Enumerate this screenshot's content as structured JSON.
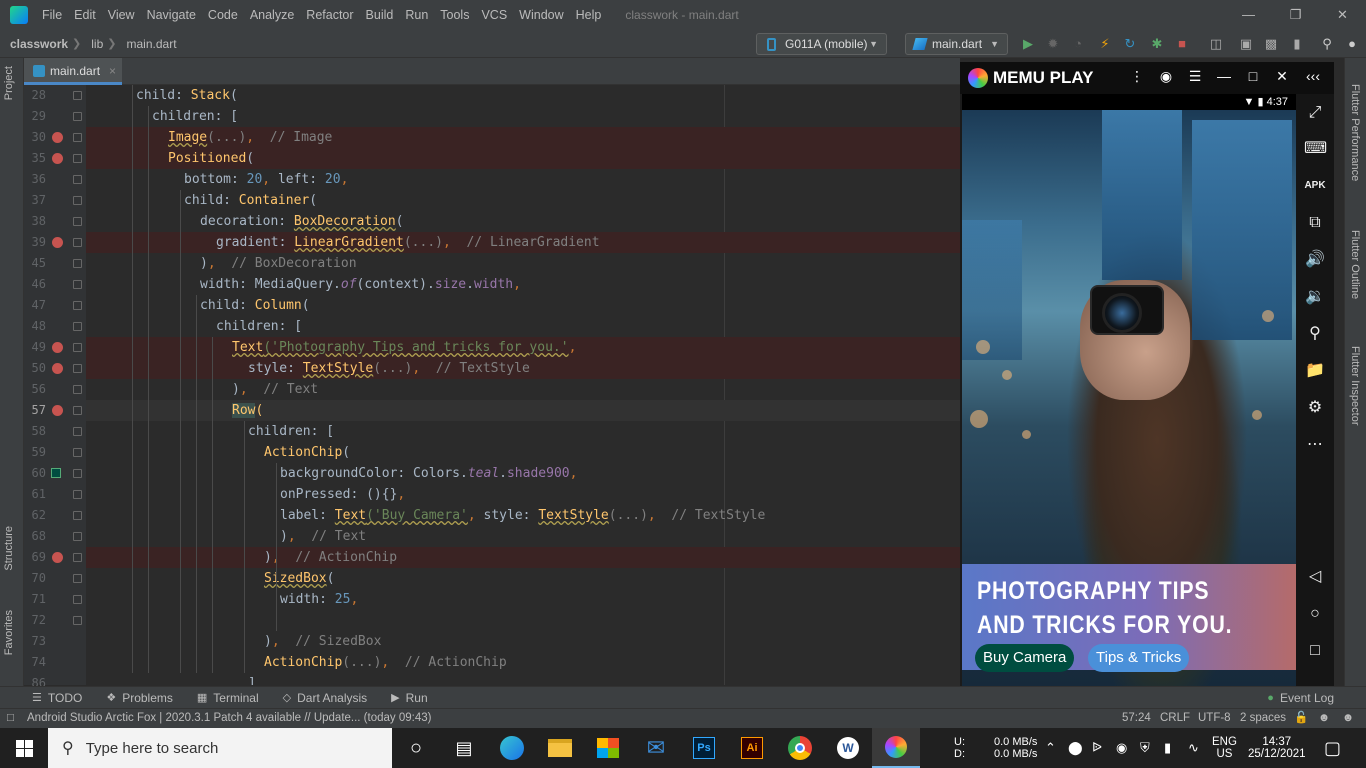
{
  "menubar": {
    "items": [
      "File",
      "Edit",
      "View",
      "Navigate",
      "Code",
      "Analyze",
      "Refactor",
      "Build",
      "Run",
      "Tools",
      "VCS",
      "Window",
      "Help"
    ],
    "window_title": "classwork - main.dart"
  },
  "navbar": {
    "breadcrumb": [
      "classwork",
      "lib",
      "main.dart"
    ],
    "device": "G011A (mobile)",
    "run_config": "main.dart"
  },
  "editor": {
    "tab": "main.dart",
    "lines": [
      {
        "no": "28",
        "parts": [
          {
            "t": "child: ",
            "c": "w"
          },
          {
            "t": "Stack",
            "c": "f"
          },
          {
            "t": "(",
            "c": "w"
          }
        ]
      },
      {
        "no": "29",
        "parts": [
          {
            "t": "children: [",
            "c": "w"
          }
        ]
      },
      {
        "no": "30",
        "parts": [
          {
            "t": "Image",
            "c": "f wv"
          },
          {
            "t": "(...)",
            "c": "c"
          },
          {
            "t": ",  ",
            "c": "k"
          },
          {
            "t": "// Image",
            "c": "c"
          }
        ]
      },
      {
        "no": "35",
        "parts": [
          {
            "t": "Positioned",
            "c": "f"
          },
          {
            "t": "(",
            "c": "w"
          }
        ]
      },
      {
        "no": "36",
        "parts": [
          {
            "t": "bottom: ",
            "c": "w"
          },
          {
            "t": "20",
            "c": "n"
          },
          {
            "t": ", ",
            "c": "k"
          },
          {
            "t": "left: ",
            "c": "w"
          },
          {
            "t": "20",
            "c": "n"
          },
          {
            "t": ",",
            "c": "k"
          }
        ]
      },
      {
        "no": "37",
        "parts": [
          {
            "t": "child: ",
            "c": "w"
          },
          {
            "t": "Container",
            "c": "f"
          },
          {
            "t": "(",
            "c": "w"
          }
        ]
      },
      {
        "no": "38",
        "parts": [
          {
            "t": "decoration: ",
            "c": "w"
          },
          {
            "t": "BoxDecoration",
            "c": "f wv"
          },
          {
            "t": "(",
            "c": "w"
          }
        ]
      },
      {
        "no": "39",
        "parts": [
          {
            "t": "gradient: ",
            "c": "w"
          },
          {
            "t": "LinearGradient",
            "c": "f wv"
          },
          {
            "t": "(...)",
            "c": "c"
          },
          {
            "t": ",  ",
            "c": "k"
          },
          {
            "t": "// LinearGradient",
            "c": "c"
          }
        ]
      },
      {
        "no": "45",
        "parts": [
          {
            "t": ")",
            "c": "w"
          },
          {
            "t": ",  ",
            "c": "k"
          },
          {
            "t": "// BoxDecoration",
            "c": "c"
          }
        ]
      },
      {
        "no": "46",
        "parts": [
          {
            "t": "width: MediaQuery.",
            "c": "w"
          },
          {
            "t": "of",
            "c": "it"
          },
          {
            "t": "(context).",
            "c": "w"
          },
          {
            "t": "size",
            "c": "fld"
          },
          {
            "t": ".",
            "c": "w"
          },
          {
            "t": "width",
            "c": "fld"
          },
          {
            "t": ",",
            "c": "k"
          }
        ]
      },
      {
        "no": "47",
        "parts": [
          {
            "t": "child: ",
            "c": "w"
          },
          {
            "t": "Column",
            "c": "f"
          },
          {
            "t": "(",
            "c": "w"
          }
        ]
      },
      {
        "no": "48",
        "parts": [
          {
            "t": "children: [",
            "c": "w"
          }
        ]
      },
      {
        "no": "49",
        "parts": [
          {
            "t": "Text",
            "c": "f wv"
          },
          {
            "t": "('Photography Tips and tricks for you.'",
            "c": "s wv"
          },
          {
            "t": ",",
            "c": "k"
          }
        ]
      },
      {
        "no": "50",
        "parts": [
          {
            "t": "style: ",
            "c": "w"
          },
          {
            "t": "TextStyle",
            "c": "f wv"
          },
          {
            "t": "(...)",
            "c": "c"
          },
          {
            "t": ",  ",
            "c": "k"
          },
          {
            "t": "// TextStyle",
            "c": "c"
          }
        ]
      },
      {
        "no": "56",
        "parts": [
          {
            "t": ")",
            "c": "w"
          },
          {
            "t": ",  ",
            "c": "k"
          },
          {
            "t": "// Text",
            "c": "c"
          }
        ]
      },
      {
        "no": "57",
        "parts": [
          {
            "t": "Row",
            "c": "hl"
          },
          {
            "t": "(",
            "c": "f"
          }
        ]
      },
      {
        "no": "58",
        "parts": [
          {
            "t": "children: [",
            "c": "w"
          }
        ]
      },
      {
        "no": "59",
        "parts": [
          {
            "t": "ActionChip",
            "c": "f"
          },
          {
            "t": "(",
            "c": "w"
          }
        ]
      },
      {
        "no": "60",
        "parts": [
          {
            "t": "backgroundColor: Colors.",
            "c": "w"
          },
          {
            "t": "teal",
            "c": "it"
          },
          {
            "t": ".",
            "c": "w"
          },
          {
            "t": "shade900",
            "c": "fld"
          },
          {
            "t": ",",
            "c": "k"
          }
        ]
      },
      {
        "no": "61",
        "parts": [
          {
            "t": "onPressed: (){}",
            "c": "w"
          },
          {
            "t": ",",
            "c": "k"
          }
        ]
      },
      {
        "no": "62",
        "parts": [
          {
            "t": "label: ",
            "c": "w"
          },
          {
            "t": "Text",
            "c": "f wv"
          },
          {
            "t": "('Buy Camera'",
            "c": "s wv"
          },
          {
            "t": ", ",
            "c": "k"
          },
          {
            "t": "style: ",
            "c": "w"
          },
          {
            "t": "TextStyle",
            "c": "f wv"
          },
          {
            "t": "(...)",
            "c": "c"
          },
          {
            "t": ",  ",
            "c": "k"
          },
          {
            "t": "// TextStyle",
            "c": "c"
          }
        ]
      },
      {
        "no": "68",
        "parts": [
          {
            "t": ")",
            "c": "w"
          },
          {
            "t": ",  ",
            "c": "k"
          },
          {
            "t": "// Text",
            "c": "c"
          }
        ]
      },
      {
        "no": "69",
        "parts": [
          {
            "t": ")",
            "c": "w"
          },
          {
            "t": ",  ",
            "c": "k"
          },
          {
            "t": "// ActionChip",
            "c": "c"
          }
        ]
      },
      {
        "no": "70",
        "parts": [
          {
            "t": "SizedBox",
            "c": "f wv"
          },
          {
            "t": "(",
            "c": "w"
          }
        ]
      },
      {
        "no": "71",
        "parts": [
          {
            "t": "width: ",
            "c": "w"
          },
          {
            "t": "25",
            "c": "n"
          },
          {
            "t": ",",
            "c": "k"
          }
        ]
      },
      {
        "no": "72",
        "parts": []
      },
      {
        "no": "73",
        "parts": [
          {
            "t": ")",
            "c": "w"
          },
          {
            "t": ",  ",
            "c": "k"
          },
          {
            "t": "// SizedBox",
            "c": "c"
          }
        ]
      },
      {
        "no": "74",
        "parts": [
          {
            "t": "ActionChip",
            "c": "f"
          },
          {
            "t": "(...)",
            "c": "c"
          },
          {
            "t": ",  ",
            "c": "k"
          },
          {
            "t": "// ActionChip",
            "c": "c"
          }
        ]
      },
      {
        "no": "86",
        "parts": [
          {
            "t": "]",
            "c": "w"
          }
        ]
      }
    ]
  },
  "emulator": {
    "brand": "MEMU PLAY",
    "time": "4:37",
    "overlay_title": "PHOTOGRAPHY TIPS AND TRICKS FOR YOU.",
    "chip1": "Buy Camera",
    "chip2": "Tips & Tricks",
    "apk": "APK",
    "chip1_color": "#004d40",
    "chip2_color": "#4a90d9"
  },
  "left_tools": [
    "Project",
    "Structure",
    "Favorites"
  ],
  "right_tools": [
    "Flutter Performance",
    "Flutter Outline",
    "Flutter Inspector"
  ],
  "bottom_tools": [
    "TODO",
    "Problems",
    "Terminal",
    "Dart Analysis",
    "Run"
  ],
  "event_log": "Event Log",
  "statusbar": {
    "message": "Android Studio Arctic Fox | 2020.3.1 Patch 4 available // Update... (today 09:43)",
    "position": "57:24",
    "line_sep": "CRLF",
    "encoding": "UTF-8",
    "indent": "2 spaces"
  },
  "taskbar": {
    "search_placeholder": "Type here to search",
    "net_u": "U:",
    "net_d": "D:",
    "net_up": "0.0 MB/s",
    "net_down": "0.0 MB/s",
    "lang": "ENG",
    "region": "US",
    "time": "14:37",
    "date": "25/12/2021"
  }
}
